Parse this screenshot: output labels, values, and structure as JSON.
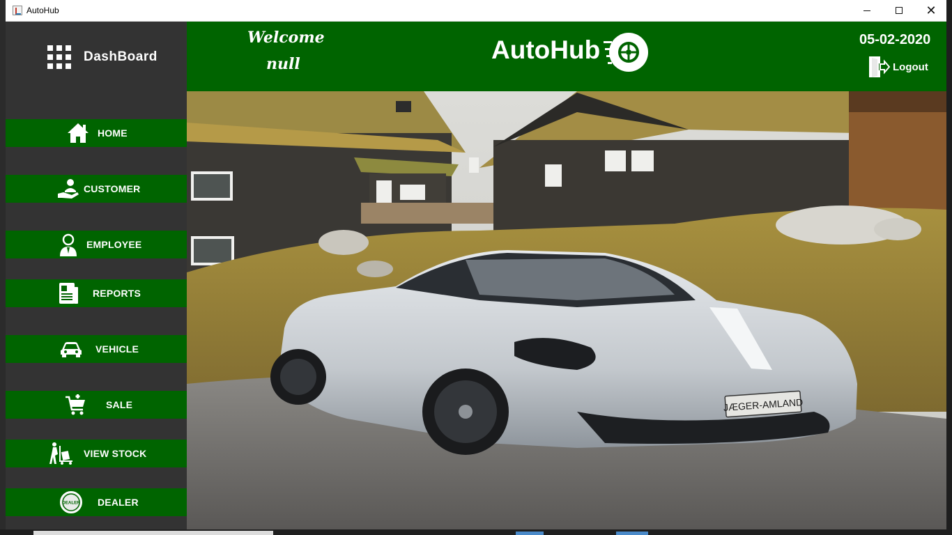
{
  "window": {
    "title": "AutoHub"
  },
  "sidebar": {
    "heading": "DashBoard",
    "items": [
      {
        "label": "HOME",
        "icon": "home-icon"
      },
      {
        "label": "CUSTOMER",
        "icon": "customer-icon"
      },
      {
        "label": "EMPLOYEE",
        "icon": "employee-icon"
      },
      {
        "label": "REPORTS",
        "icon": "reports-icon"
      },
      {
        "label": "VEHICLE",
        "icon": "car-icon"
      },
      {
        "label": "SALE",
        "icon": "cart-icon"
      },
      {
        "label": "VIEW STOCK",
        "icon": "stock-trolley-icon"
      },
      {
        "label": "DEALER",
        "icon": "dealer-badge-icon"
      }
    ]
  },
  "header": {
    "welcome": "Welcome",
    "user": "null",
    "brand": "AutoHub",
    "date": "05-02-2020",
    "logout_label": "Logout"
  },
  "hero": {
    "plate_text": "JÆGER-AMLAND"
  },
  "colors": {
    "header_green": "#006400",
    "sidebar_bg": "#333333",
    "text_white": "#ffffff"
  }
}
